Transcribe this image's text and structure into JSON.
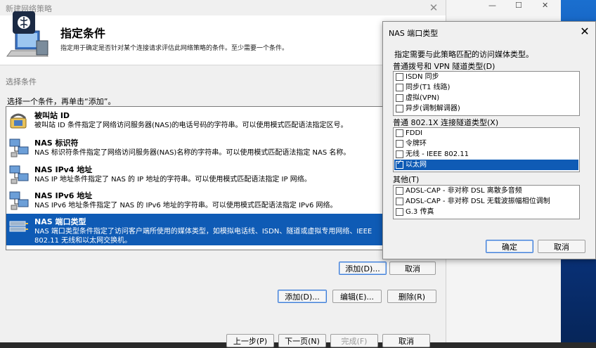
{
  "window": {
    "title": "新建网络策略",
    "close": "✕"
  },
  "header": {
    "title": "指定条件",
    "subtitle": "指定用于确定是否针对某个连接请求评估此网络策略的条件。至少需要一个条件。"
  },
  "section_label": "选择条件",
  "instruction": "选择一个条件，再单击“添加”。",
  "conditions": [
    {
      "title": "被叫站 ID",
      "desc": "被叫站 ID 条件指定了网络访问服务器(NAS)的电话号码的字符串。可以使用模式匹配语法指定区号。",
      "desc2": ""
    },
    {
      "title": "NAS 标识符",
      "desc": "NAS 标识符条件指定了网络访问服务器(NAS)名称的字符串。可以使用模式匹配语法指定 NAS 名称。",
      "desc2": ""
    },
    {
      "title": "NAS IPv4 地址",
      "desc": "NAS IP 地址条件指定了 NAS 的 IP 地址的字符串。可以使用模式匹配语法指定 IP 网络。",
      "desc2": ""
    },
    {
      "title": "NAS IPv6 地址",
      "desc": "NAS IPv6 地址条件指定了 NAS 的 IPv6 地址的字符串。可以使用模式匹配语法指定 IPv6 网络。",
      "desc2": ""
    },
    {
      "title": "NAS 端口类型",
      "desc": "NAS 端口类型条件指定了访问客户端所使用的媒体类型，如模拟电话线、ISDN、隧道或虚拟专用网络、IEEE",
      "desc2": "802.11 无线和以太网交换机。"
    }
  ],
  "buttons": {
    "add_cond": "添加(D)...",
    "cancel_cond": "取消",
    "add": "添加(D)...",
    "edit": "编辑(E)...",
    "delete": "删除(R)",
    "prev": "上一步(P)",
    "next": "下一页(N)",
    "finish": "完成(F)",
    "cancel": "取消"
  },
  "dialog": {
    "title": "NAS 端口类型",
    "close": "✕",
    "desc": "指定需要与此策略匹配的访问媒体类型。",
    "groups": [
      {
        "label": "普通拨号和 VPN 隧道类型(D)",
        "items": [
          {
            "label": "ISDN 同步",
            "checked": false,
            "selected": false
          },
          {
            "label": "同步(T1 线路)",
            "checked": false,
            "selected": false
          },
          {
            "label": "虚拟(VPN)",
            "checked": false,
            "selected": false
          },
          {
            "label": "异步(调制解调器)",
            "checked": false,
            "selected": false
          }
        ]
      },
      {
        "label": "普通 802.1X 连接隧道类型(X)",
        "items": [
          {
            "label": "FDDI",
            "checked": false,
            "selected": false
          },
          {
            "label": "令牌环",
            "checked": false,
            "selected": false
          },
          {
            "label": "无线 - IEEE 802.11",
            "checked": false,
            "selected": false
          },
          {
            "label": "以太网",
            "checked": true,
            "selected": true
          }
        ]
      },
      {
        "label": "其他(T)",
        "items": [
          {
            "label": "ADSL-CAP - 非对称 DSL 离散多音频",
            "checked": false,
            "selected": false
          },
          {
            "label": "ADSL-CAP - 非对称 DSL 无载波振幅相位调制",
            "checked": false,
            "selected": false
          },
          {
            "label": "G.3 传真",
            "checked": false,
            "selected": false
          }
        ]
      }
    ],
    "ok": "确定",
    "cancel": "取消"
  },
  "side_window": {
    "minimize": "—",
    "maximize": "☐",
    "close": "✕"
  },
  "colors": {
    "selection": "#0f5bb5",
    "dialog_bg": "#f0f0f0"
  }
}
